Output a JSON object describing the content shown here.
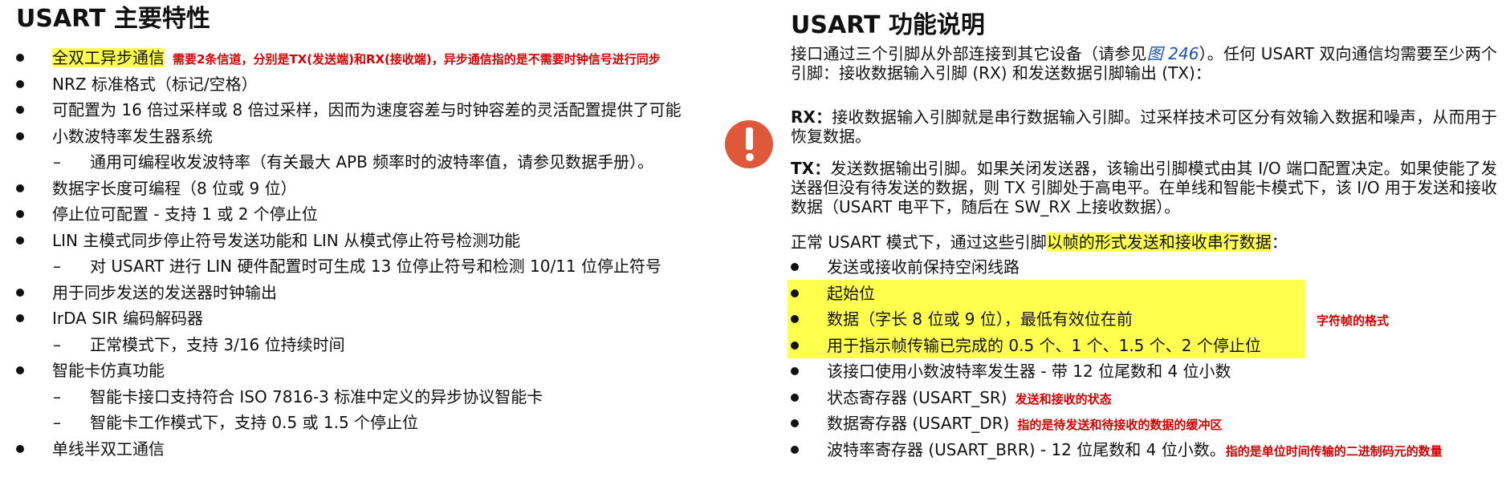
{
  "left": {
    "title": "USART 主要特性",
    "items": [
      {
        "kind": "bullet",
        "text": "全双工异步通信",
        "highlight": true,
        "note": "需要2条信道，分别是TX(发送端)和RX(接收端)，异步通信指的是不需要时钟信号进行同步"
      },
      {
        "kind": "bullet",
        "text": "NRZ 标准格式（标记/空格）"
      },
      {
        "kind": "bullet",
        "text": "可配置为 16 倍过采样或 8 倍过采样，因而为速度容差与时钟容差的灵活配置提供了可能"
      },
      {
        "kind": "bullet",
        "text": "小数波特率发生器系统"
      },
      {
        "kind": "sub",
        "text": "通用可编程收发波特率（有关最大 APB 频率时的波特率值，请参见数据手册）。"
      },
      {
        "kind": "bullet",
        "text": "数据字长度可编程（8 位或 9 位）"
      },
      {
        "kind": "bullet",
        "text": "停止位可配置 - 支持 1 或 2 个停止位"
      },
      {
        "kind": "bullet",
        "text": "LIN 主模式同步停止符号发送功能和 LIN 从模式停止符号检测功能"
      },
      {
        "kind": "sub",
        "text": "对 USART 进行 LIN 硬件配置时可生成 13 位停止符号和检测 10/11 位停止符号"
      },
      {
        "kind": "bullet",
        "text": "用于同步发送的发送器时钟输出"
      },
      {
        "kind": "bullet",
        "text": "IrDA SIR 编码解码器"
      },
      {
        "kind": "sub",
        "text": "正常模式下，支持 3/16 位持续时间"
      },
      {
        "kind": "bullet",
        "text": "智能卡仿真功能"
      },
      {
        "kind": "sub",
        "text": "智能卡接口支持符合 ISO 7816-3 标准中定义的异步协议智能卡"
      },
      {
        "kind": "sub",
        "text": "智能卡工作模式下，支持 0.5 或 1.5 个停止位"
      },
      {
        "kind": "bullet",
        "text": "单线半双工通信"
      }
    ],
    "sub_dash": "–"
  },
  "right": {
    "title": "USART 功能说明",
    "intro": {
      "before": "接口通过三个引脚从外部连接到其它设备（请参见",
      "link": "图 246",
      "after": "）。任何 USART 双向通信均需要至少两个引脚：接收数据输入引脚 (RX) 和发送数据引脚输出 (TX)："
    },
    "rx": {
      "label": "RX：",
      "text": "接收数据输入引脚就是串行数据输入引脚。过采样技术可区分有效输入数据和噪声，从而用于恢复数据。"
    },
    "tx": {
      "label": "TX：",
      "text": "发送数据输出引脚。如果关闭发送器，该输出引脚模式由其 I/O 端口配置决定。如果使能了发送器但没有待发送的数据，则 TX 引脚处于高电平。在单线和智能卡模式下，该 I/O 用于发送和接收数据（USART 电平下，随后在 SW_RX 上接收数据）。"
    },
    "normal": {
      "before": "正常 USART 模式下，通过这些引脚",
      "highlight": "以帧的形式发送和接收串行数据",
      "after": "："
    },
    "frame_note": "字符帧的格式",
    "items": [
      {
        "text": "发送或接收前保持空闲线路"
      },
      {
        "text": "起始位"
      },
      {
        "text": "数据（字长 8 位或 9 位），最低有效位在前"
      },
      {
        "text": "用于指示帧传输已完成的 0.5 个、1 个、1.5 个、2 个停止位"
      },
      {
        "text": "该接口使用小数波特率发生器 - 带 12 位尾数和 4 位小数"
      },
      {
        "text": "状态寄存器 (USART_SR)",
        "note": "发送和接收的状态"
      },
      {
        "text": "数据寄存器 (USART_DR)",
        "note": "指的是待发送和待接收的数据的缓冲区"
      },
      {
        "text": "波特率寄存器 (USART_BRR) - 12 位尾数和 4 位小数。",
        "note": "指的是单位时间传输的二进制码元的数量"
      }
    ]
  },
  "icons": {
    "warning": "exclamation-circle-icon",
    "warning_color": "#e0583a",
    "highlight_color": "#ffff4d",
    "note_color": "#d40000"
  }
}
